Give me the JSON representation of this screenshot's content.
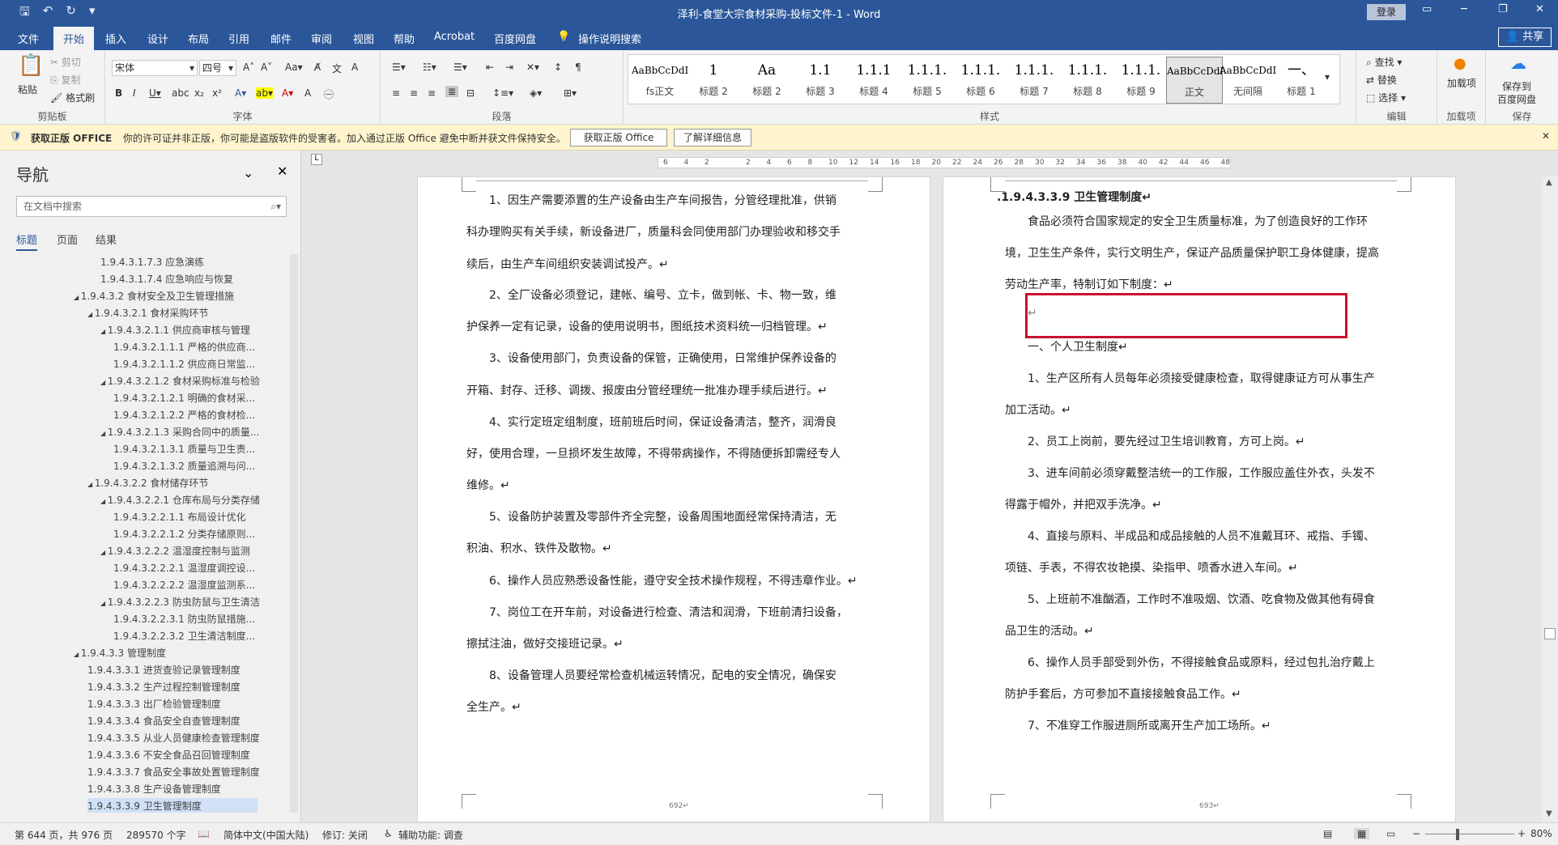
{
  "title_bar": {
    "document_title": "泽利-食堂大宗食材采购-投标文件-1  -  Word",
    "login_label": "登录",
    "qat": [
      "save-icon",
      "undo-icon",
      "redo-icon",
      "customize-icon"
    ]
  },
  "menu": {
    "items": [
      "文件",
      "开始",
      "插入",
      "设计",
      "布局",
      "引用",
      "邮件",
      "审阅",
      "视图",
      "帮助",
      "Acrobat",
      "百度网盘",
      "操作说明搜索"
    ],
    "active": "开始",
    "share_label": "共享"
  },
  "ribbon": {
    "clipboard": {
      "paste": "粘贴",
      "cut": "剪切",
      "copy": "复制",
      "format_painter": "格式刷",
      "label": "剪贴板"
    },
    "font": {
      "font_name": "宋体",
      "font_size": "四号",
      "label": "字体"
    },
    "paragraph": {
      "label": "段落"
    },
    "styles": {
      "items": [
        {
          "preview": "AaBbCcDdI",
          "name": "fs正文"
        },
        {
          "preview": "1",
          "name": "标题 2"
        },
        {
          "preview": "Aa",
          "name": "标题 2"
        },
        {
          "preview": "1.1",
          "name": "标题 3"
        },
        {
          "preview": "1.1.1",
          "name": "标题 4"
        },
        {
          "preview": "1.1.1.",
          "name": "标题 5"
        },
        {
          "preview": "1.1.1.",
          "name": "标题 6"
        },
        {
          "preview": "1.1.1.",
          "name": "标题 7"
        },
        {
          "preview": "1.1.1.",
          "name": "标题 8"
        },
        {
          "preview": "1.1.1.",
          "name": "标题 9"
        },
        {
          "preview": "AaBbCcDdI",
          "name": "正文",
          "selected": true
        },
        {
          "preview": "AaBbCcDdI",
          "name": "无间隔"
        },
        {
          "preview": "一、",
          "name": "标题 1"
        }
      ],
      "label": "样式"
    },
    "editing": {
      "find": "查找",
      "replace": "替换",
      "select": "选择",
      "label": "编辑"
    },
    "addins": {
      "btn": "加载项",
      "label": "加载项"
    },
    "baidu": {
      "btn1": "保存到",
      "btn2": "百度网盘",
      "label": "保存"
    }
  },
  "notice": {
    "title": "获取正版 OFFICE",
    "message": "你的许可证并非正版，你可能是盗版软件的受害者。加入通过正版 Office 避免中断并获文件保持安全。",
    "btn1": "获取正版 Office",
    "btn2": "了解详细信息"
  },
  "nav": {
    "title": "导航",
    "search_placeholder": "在文档中搜索",
    "tabs": [
      "标题",
      "页面",
      "结果"
    ],
    "items": [
      {
        "text": "1.9.4.3.1.7.3 应急演练",
        "level": 4
      },
      {
        "text": "1.9.4.3.1.7.4 应急响应与恢复",
        "level": 4
      },
      {
        "text": "1.9.4.3.2 食材安全及卫生管理措施",
        "level": 2,
        "exp": true
      },
      {
        "text": "1.9.4.3.2.1 食材采购环节",
        "level": 3,
        "exp": true
      },
      {
        "text": "1.9.4.3.2.1.1 供应商审核与管理",
        "level": 4,
        "exp": true
      },
      {
        "text": "1.9.4.3.2.1.1.1 严格的供应商...",
        "level": 5
      },
      {
        "text": "1.9.4.3.2.1.1.2 供应商日常监...",
        "level": 5
      },
      {
        "text": "1.9.4.3.2.1.2 食材采购标准与检验",
        "level": 4,
        "exp": true
      },
      {
        "text": "1.9.4.3.2.1.2.1 明确的食材采...",
        "level": 5
      },
      {
        "text": "1.9.4.3.2.1.2.2 严格的食材检...",
        "level": 5
      },
      {
        "text": "1.9.4.3.2.1.3 采购合同中的质量...",
        "level": 4,
        "exp": true
      },
      {
        "text": "1.9.4.3.2.1.3.1 质量与卫生责...",
        "level": 5
      },
      {
        "text": "1.9.4.3.2.1.3.2 质量追溯与问...",
        "level": 5
      },
      {
        "text": "1.9.4.3.2.2 食材储存环节",
        "level": 3,
        "exp": true
      },
      {
        "text": "1.9.4.3.2.2.1 仓库布局与分类存储",
        "level": 4,
        "exp": true
      },
      {
        "text": "1.9.4.3.2.2.1.1 布局设计优化",
        "level": 5
      },
      {
        "text": "1.9.4.3.2.2.1.2 分类存储原则...",
        "level": 5
      },
      {
        "text": "1.9.4.3.2.2.2 温湿度控制与监测",
        "level": 4,
        "exp": true
      },
      {
        "text": "1.9.4.3.2.2.2.1 温湿度调控设...",
        "level": 5
      },
      {
        "text": "1.9.4.3.2.2.2.2 温湿度监测系...",
        "level": 5
      },
      {
        "text": "1.9.4.3.2.2.3 防虫防鼠与卫生清洁",
        "level": 4,
        "exp": true
      },
      {
        "text": "1.9.4.3.2.2.3.1 防虫防鼠措施...",
        "level": 5
      },
      {
        "text": "1.9.4.3.2.2.3.2 卫生清洁制度...",
        "level": 5
      },
      {
        "text": "1.9.4.3.3 管理制度",
        "level": 2,
        "exp": true
      },
      {
        "text": "1.9.4.3.3.1 进货查验记录管理制度",
        "level": 3
      },
      {
        "text": "1.9.4.3.3.2 生产过程控制管理制度",
        "level": 3
      },
      {
        "text": "1.9.4.3.3.3 出厂检验管理制度",
        "level": 3
      },
      {
        "text": "1.9.4.3.3.4 食品安全自查管理制度",
        "level": 3
      },
      {
        "text": "1.9.4.3.3.5 从业人员健康检查管理制度",
        "level": 3
      },
      {
        "text": "1.9.4.3.3.6 不安全食品召回管理制度",
        "level": 3
      },
      {
        "text": "1.9.4.3.3.7 食品安全事故处置管理制度",
        "level": 3
      },
      {
        "text": "1.9.4.3.3.8 生产设备管理制度",
        "level": 3
      },
      {
        "text": "1.9.4.3.3.9 卫生管理制度",
        "level": 3,
        "selected": true
      }
    ]
  },
  "ruler": {
    "marks": [
      "6",
      "4",
      "2",
      "",
      "2",
      "4",
      "6",
      "8",
      "10",
      "12",
      "14",
      "16",
      "18",
      "20",
      "22",
      "24",
      "26",
      "28",
      "30",
      "32",
      "34",
      "36",
      "38",
      "40",
      "42",
      "44",
      "46",
      "48"
    ]
  },
  "left_page": {
    "lines": [
      "1、因生产需要添置的生产设备由生产车间报告，分管经理批准，供销",
      "科办理购买有关手续，新设备进厂，质量科会同使用部门办理验收和移交手",
      "续后，由生产车间组织安装调试投产。↵",
      "2、全厂设备必须登记，建帐、编号、立卡，做到帐、卡、物一致，维",
      "护保养一定有记录，设备的使用说明书，图纸技术资料统一归档管理。↵",
      "3、设备使用部门，负责设备的保管，正确使用，日常维护保养设备的",
      "开箱、封存、迁移、调拨、报废由分管经理统一批准办理手续后进行。↵",
      "4、实行定班定组制度，班前班后时间，保证设备清洁，整齐，润滑良",
      "好，使用合理，一旦损坏发生故障，不得带病操作，不得随便拆卸需经专人",
      "维修。↵",
      "5、设备防护装置及零部件齐全完整，设备周围地面经常保持清洁，无",
      "积油、积水、铁件及散物。↵",
      "6、操作人员应熟悉设备性能，遵守安全技术操作规程，不得违章作业。↵",
      "7、岗位工在开车前，对设备进行检查、清洁和润滑，下班前清扫设备，",
      "擦拭注油，做好交接班记录。↵",
      "8、设备管理人员要经常检查机械运转情况，配电的安全情况，确保安",
      "全生产。↵"
    ],
    "page_no": "692↵"
  },
  "right_page": {
    "heading": ".1.9.4.3.3.9  卫生管理制度↵",
    "lines": [
      "食品必须符合国家规定的安全卫生质量标准，为了创造良好的工作环",
      "境，卫生生产条件，实行文明生产，保证产品质量保护职工身体健康，提高",
      "劳动生产率，特制订如下制度：↵",
      "↵",
      "一、个人卫生制度↵",
      "1、生产区所有人员每年必须接受健康检查，取得健康证方可从事生产",
      "加工活动。↵",
      "2、员工上岗前，要先经过卫生培训教育，方可上岗。↵",
      "3、进车间前必须穿戴整洁统一的工作服，工作服应盖住外衣，头发不",
      "得露于帽外，并把双手洗净。↵",
      "4、直接与原料、半成品和成品接触的人员不准戴耳环、戒指、手镯、",
      "项链、手表，不得农妆艳摸、染指甲、喷香水进入车间。↵",
      "5、上班前不准酗酒，工作时不准吸烟、饮酒、吃食物及做其他有碍食",
      "品卫生的活动。↵",
      "6、操作人员手部受到外伤，不得接触食品或原料，经过包扎治疗戴上",
      "防护手套后，方可参加不直接接触食品工作。↵",
      "7、不准穿工作服进厕所或离开生产加工场所。↵"
    ],
    "page_no": "693↵"
  },
  "status": {
    "page": "第 644 页，共 976 页",
    "words": "289570 个字",
    "lang": "简体中文(中国大陆)",
    "track": "修订: 关闭",
    "access": "辅助功能: 调查",
    "zoom": "80%"
  }
}
